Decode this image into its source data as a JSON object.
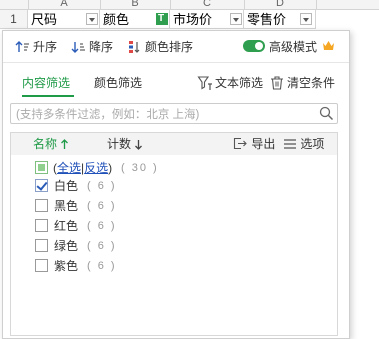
{
  "sheet": {
    "column_letters": [
      "A",
      "B",
      "C",
      "D"
    ],
    "row_number": "1",
    "headers": [
      {
        "label": "尺码",
        "filter_active": false
      },
      {
        "label": "颜色",
        "filter_active": true
      },
      {
        "label": "市场价",
        "filter_active": false
      },
      {
        "label": "零售价",
        "filter_active": false
      }
    ]
  },
  "panel": {
    "sort_asc": "升序",
    "sort_desc": "降序",
    "sort_color": "颜色排序",
    "advanced_mode": "高级模式",
    "advanced_on": true,
    "tabs": [
      "内容筛选",
      "颜色筛选"
    ],
    "active_tab": 0,
    "text_filter": "文本筛选",
    "clear_conditions": "清空条件",
    "search_placeholder": "(支持多条件过滤，例如：北京  上海)",
    "list_header": {
      "name": "名称",
      "count": "计数",
      "export": "导出",
      "options": "选项"
    },
    "select_all": {
      "open_paren": "(",
      "all": "全选",
      "sep": "|",
      "invert": "反选",
      "close_paren": ")",
      "count": "( 30 )"
    },
    "items": [
      {
        "label": "白色",
        "count": "( 6 )",
        "checked": true
      },
      {
        "label": "黑色",
        "count": "( 6 )",
        "checked": false
      },
      {
        "label": "红色",
        "count": "( 6 )",
        "checked": false
      },
      {
        "label": "绿色",
        "count": "( 6 )",
        "checked": false
      },
      {
        "label": "紫色",
        "count": "( 6 )",
        "checked": false
      }
    ]
  },
  "colors": {
    "accent_green": "#1f9a47",
    "link_blue": "#1f4fb8",
    "crown_orange": "#f5a623"
  },
  "icons": [
    "sort-asc-icon",
    "sort-desc-icon",
    "color-sort-icon",
    "crown-icon",
    "text-filter-icon",
    "trash-icon",
    "search-icon",
    "export-icon",
    "options-icon"
  ]
}
